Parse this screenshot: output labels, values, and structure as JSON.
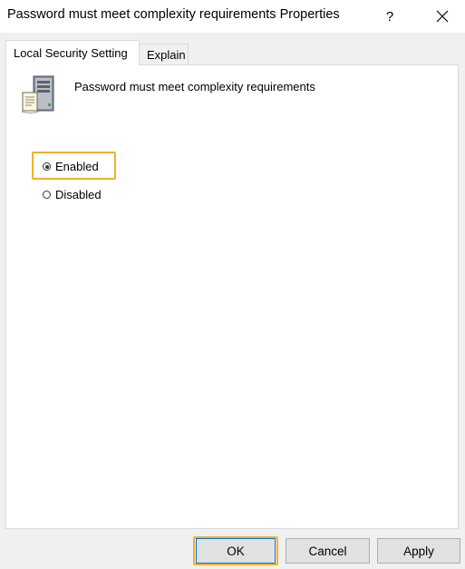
{
  "window": {
    "title": "Password must meet complexity requirements Properties",
    "help_label": "?",
    "close_icon": "close-icon"
  },
  "tabs": [
    {
      "label": "Local Security Setting",
      "active": true
    },
    {
      "label": "Explain",
      "active": false
    }
  ],
  "policy": {
    "icon": "server-policy-icon",
    "name": "Password must meet complexity requirements"
  },
  "options": [
    {
      "label": "Enabled",
      "selected": true
    },
    {
      "label": "Disabled",
      "selected": false
    }
  ],
  "buttons": {
    "ok": "OK",
    "cancel": "Cancel",
    "apply": "Apply"
  },
  "colors": {
    "highlight": "#f0b030",
    "dialog_bg": "#f0f0f0",
    "default_button_border": "#0078d7"
  }
}
